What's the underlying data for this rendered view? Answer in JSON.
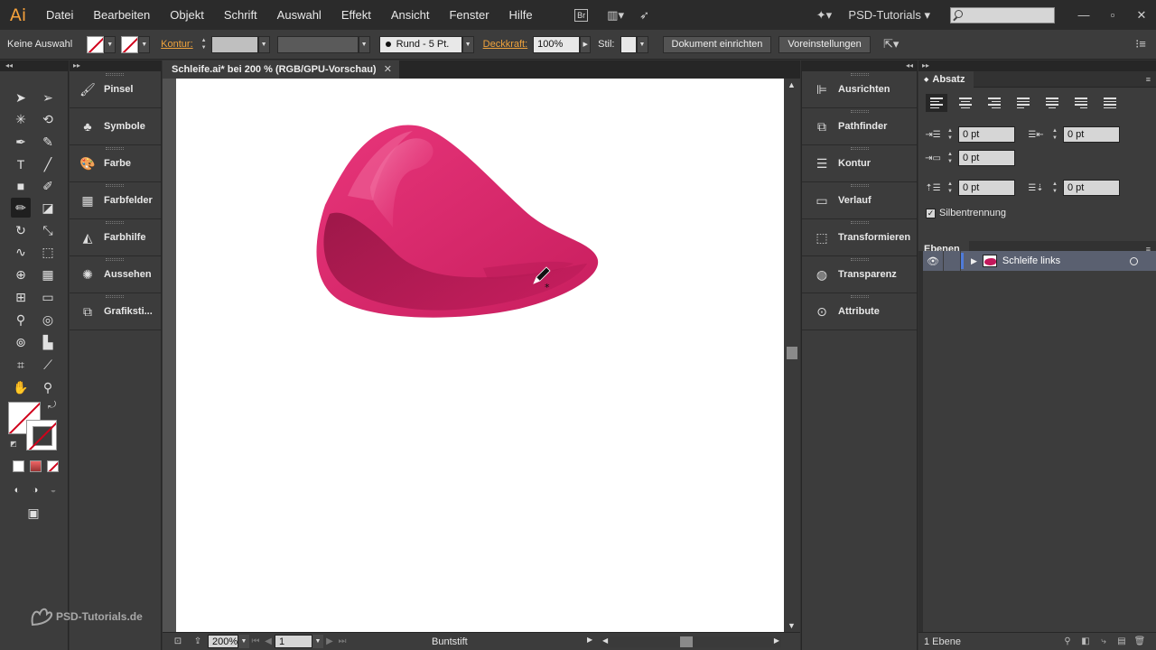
{
  "menubar": {
    "logo": "Ai",
    "items": [
      "Datei",
      "Bearbeiten",
      "Objekt",
      "Schrift",
      "Auswahl",
      "Effekt",
      "Ansicht",
      "Fenster",
      "Hilfe"
    ],
    "bridge_label": "Br",
    "workspace": "PSD-Tutorials",
    "search_value": ""
  },
  "controlbar": {
    "selection_status": "Keine Auswahl",
    "stroke_label": "Kontur:",
    "stroke_style": "Rund - 5 Pt.",
    "opacity_label": "Deckkraft:",
    "opacity_value": "100%",
    "style_label": "Stil:",
    "document_setup": "Dokument einrichten",
    "preferences": "Voreinstellungen"
  },
  "document": {
    "tab_title": "Schleife.ai* bei 200 % (RGB/GPU-Vorschau)"
  },
  "statusbar": {
    "zoom": "200%",
    "artboard": "1",
    "current_tool": "Buntstift"
  },
  "left_panels": [
    {
      "label": "Pinsel",
      "icon": "brush-icon"
    },
    {
      "label": "Symbole",
      "icon": "club-icon"
    },
    {
      "label": "Farbe",
      "icon": "palette-icon"
    },
    {
      "label": "Farbfelder",
      "icon": "swatches-icon"
    },
    {
      "label": "Farbhilfe",
      "icon": "color-guide-icon"
    },
    {
      "label": "Aussehen",
      "icon": "appearance-icon"
    },
    {
      "label": "Grafiksti...",
      "icon": "graphic-styles-icon"
    }
  ],
  "mid_panels": [
    {
      "label": "Ausrichten",
      "icon": "align-icon"
    },
    {
      "label": "Pathfinder",
      "icon": "pathfinder-icon"
    },
    {
      "label": "Kontur",
      "icon": "stroke-icon"
    },
    {
      "label": "Verlauf",
      "icon": "gradient-icon"
    },
    {
      "label": "Transformieren",
      "icon": "transform-icon"
    },
    {
      "label": "Transparenz",
      "icon": "transparency-icon"
    },
    {
      "label": "Attribute",
      "icon": "attributes-icon"
    }
  ],
  "paragraph_panel": {
    "title": "Absatz",
    "left_indent": "0 pt",
    "right_indent": "0 pt",
    "first_line_indent": "0 pt",
    "space_before": "0 pt",
    "space_after": "0 pt",
    "hyphenation_label": "Silbentrennung",
    "hyphenation_checked": true
  },
  "layers_panel": {
    "title": "Ebenen",
    "layers": [
      {
        "name": "Schleife links"
      }
    ],
    "count_label": "1 Ebene"
  },
  "watermark": "PSD-Tutorials.de",
  "colors": {
    "accent_orange": "#f0a33c",
    "shape_pink": "#d6266a",
    "layer_color": "#4f7bd9"
  }
}
